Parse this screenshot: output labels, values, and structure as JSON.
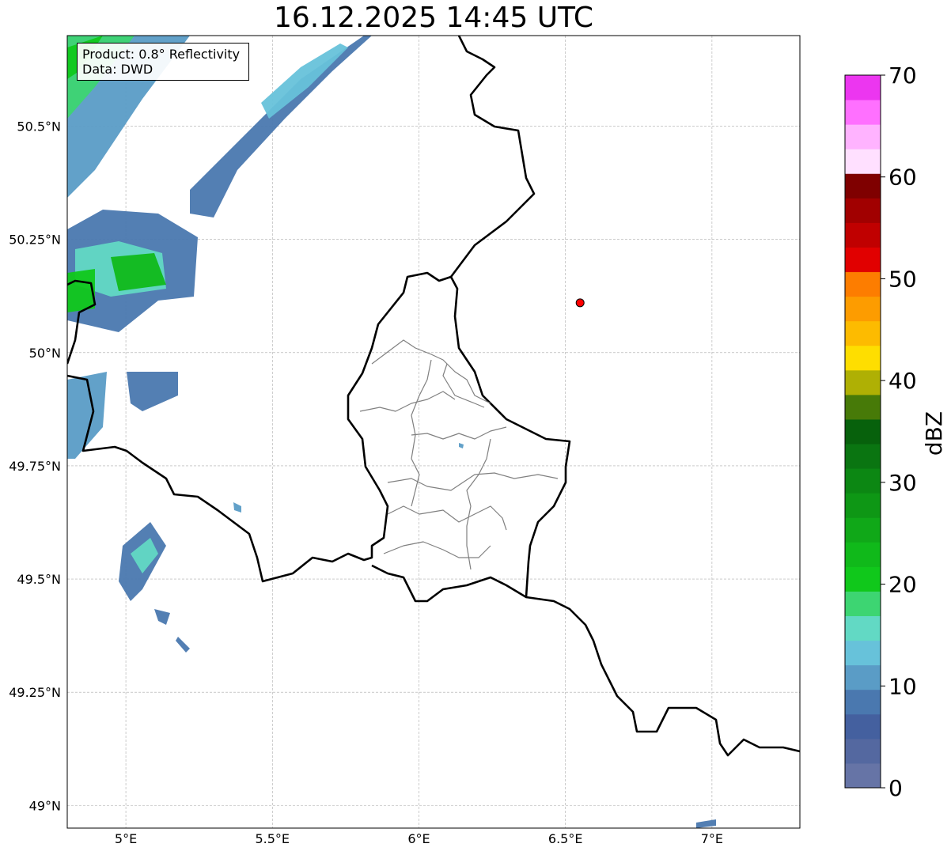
{
  "title": "16.12.2025 14:45 UTC",
  "info": {
    "product": "Product: 0.8° Reflectivity",
    "data": "Data: DWD"
  },
  "map": {
    "lon_range": [
      4.8,
      7.3
    ],
    "lat_range": [
      48.95,
      50.7
    ],
    "x_ticks": [
      {
        "value": 5.0,
        "label": "5°E"
      },
      {
        "value": 5.5,
        "label": "5.5°E"
      },
      {
        "value": 6.0,
        "label": "6°E"
      },
      {
        "value": 6.5,
        "label": "6.5°E"
      },
      {
        "value": 7.0,
        "label": "7°E"
      }
    ],
    "y_ticks": [
      {
        "value": 50.5,
        "label": "50.5°N"
      },
      {
        "value": 50.25,
        "label": "50.25°N"
      },
      {
        "value": 50.0,
        "label": "50°N"
      },
      {
        "value": 49.75,
        "label": "49.75°N"
      },
      {
        "value": 49.5,
        "label": "49.5°N"
      },
      {
        "value": 49.25,
        "label": "49.25°N"
      },
      {
        "value": 49.0,
        "label": "49°N"
      }
    ],
    "gridlines": true,
    "marker": {
      "lon": 6.55,
      "lat": 50.11,
      "color": "#ff0000"
    }
  },
  "colorbar": {
    "label": "dBZ",
    "min": 0,
    "max": 70,
    "ticks": [
      0,
      10,
      20,
      30,
      40,
      50,
      60,
      70
    ],
    "colors": [
      "#6674a6",
      "#5468a0",
      "#44609f",
      "#4a78af",
      "#5a9cc6",
      "#67c2da",
      "#62d9c4",
      "#3dd572",
      "#10c81b",
      "#10b91a",
      "#10a818",
      "#0e9715",
      "#0c8713",
      "#0a7511",
      "#07610c",
      "#477a08",
      "#afb004",
      "#fede00",
      "#fdbb00",
      "#fd9c00",
      "#fd7d00",
      "#e10000",
      "#c00000",
      "#a10000",
      "#7f0000",
      "#ffe0ff",
      "#ffb3ff",
      "#ff70ff",
      "#ec36f0"
    ]
  }
}
